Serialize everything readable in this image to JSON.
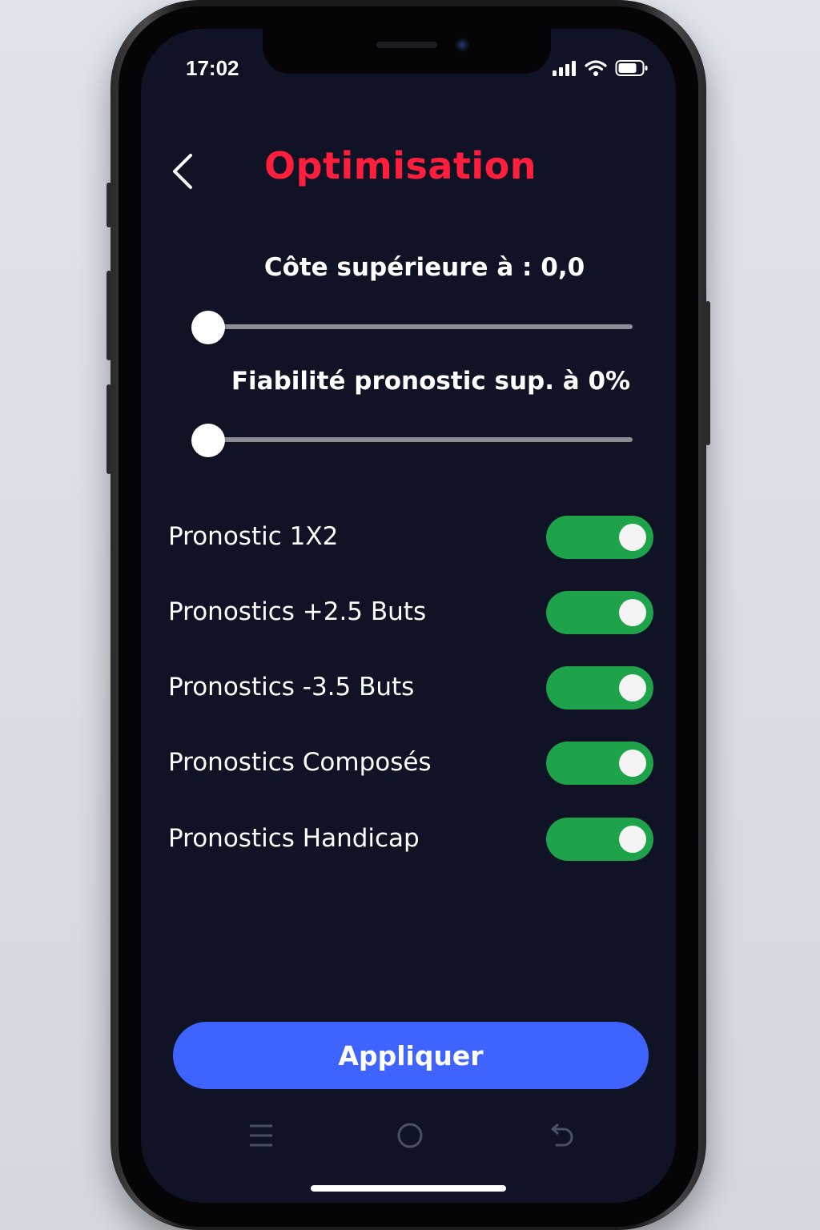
{
  "status_bar": {
    "time": "17:02",
    "icons": [
      "signal-icon",
      "wifi-icon",
      "battery-icon"
    ]
  },
  "header": {
    "title": "Optimisation",
    "back_icon": "chevron-left-icon"
  },
  "sliders": [
    {
      "label": "Côte supérieure à : 0,0",
      "value": 0.0,
      "min": 0,
      "max": 1
    },
    {
      "label": "Fiabilité pronostic sup. à 0%",
      "value": 0.0,
      "min": 0,
      "max": 1
    }
  ],
  "toggles": [
    {
      "label": "Pronostic 1X2",
      "on": true
    },
    {
      "label": "Pronostics +2.5 Buts",
      "on": true
    },
    {
      "label": "Pronostics -3.5 Buts",
      "on": true
    },
    {
      "label": "Pronostics Composés",
      "on": true
    },
    {
      "label": "Pronostics Handicap",
      "on": true
    }
  ],
  "apply_button": {
    "label": "Appliquer"
  },
  "nav_bar": {
    "items": [
      "menu-icon",
      "home-icon",
      "back-icon"
    ]
  },
  "colors": {
    "background": "#0f1325",
    "title": "#ff1f3d",
    "toggle_on": "#1fa34a",
    "button": "#3f63ff"
  }
}
